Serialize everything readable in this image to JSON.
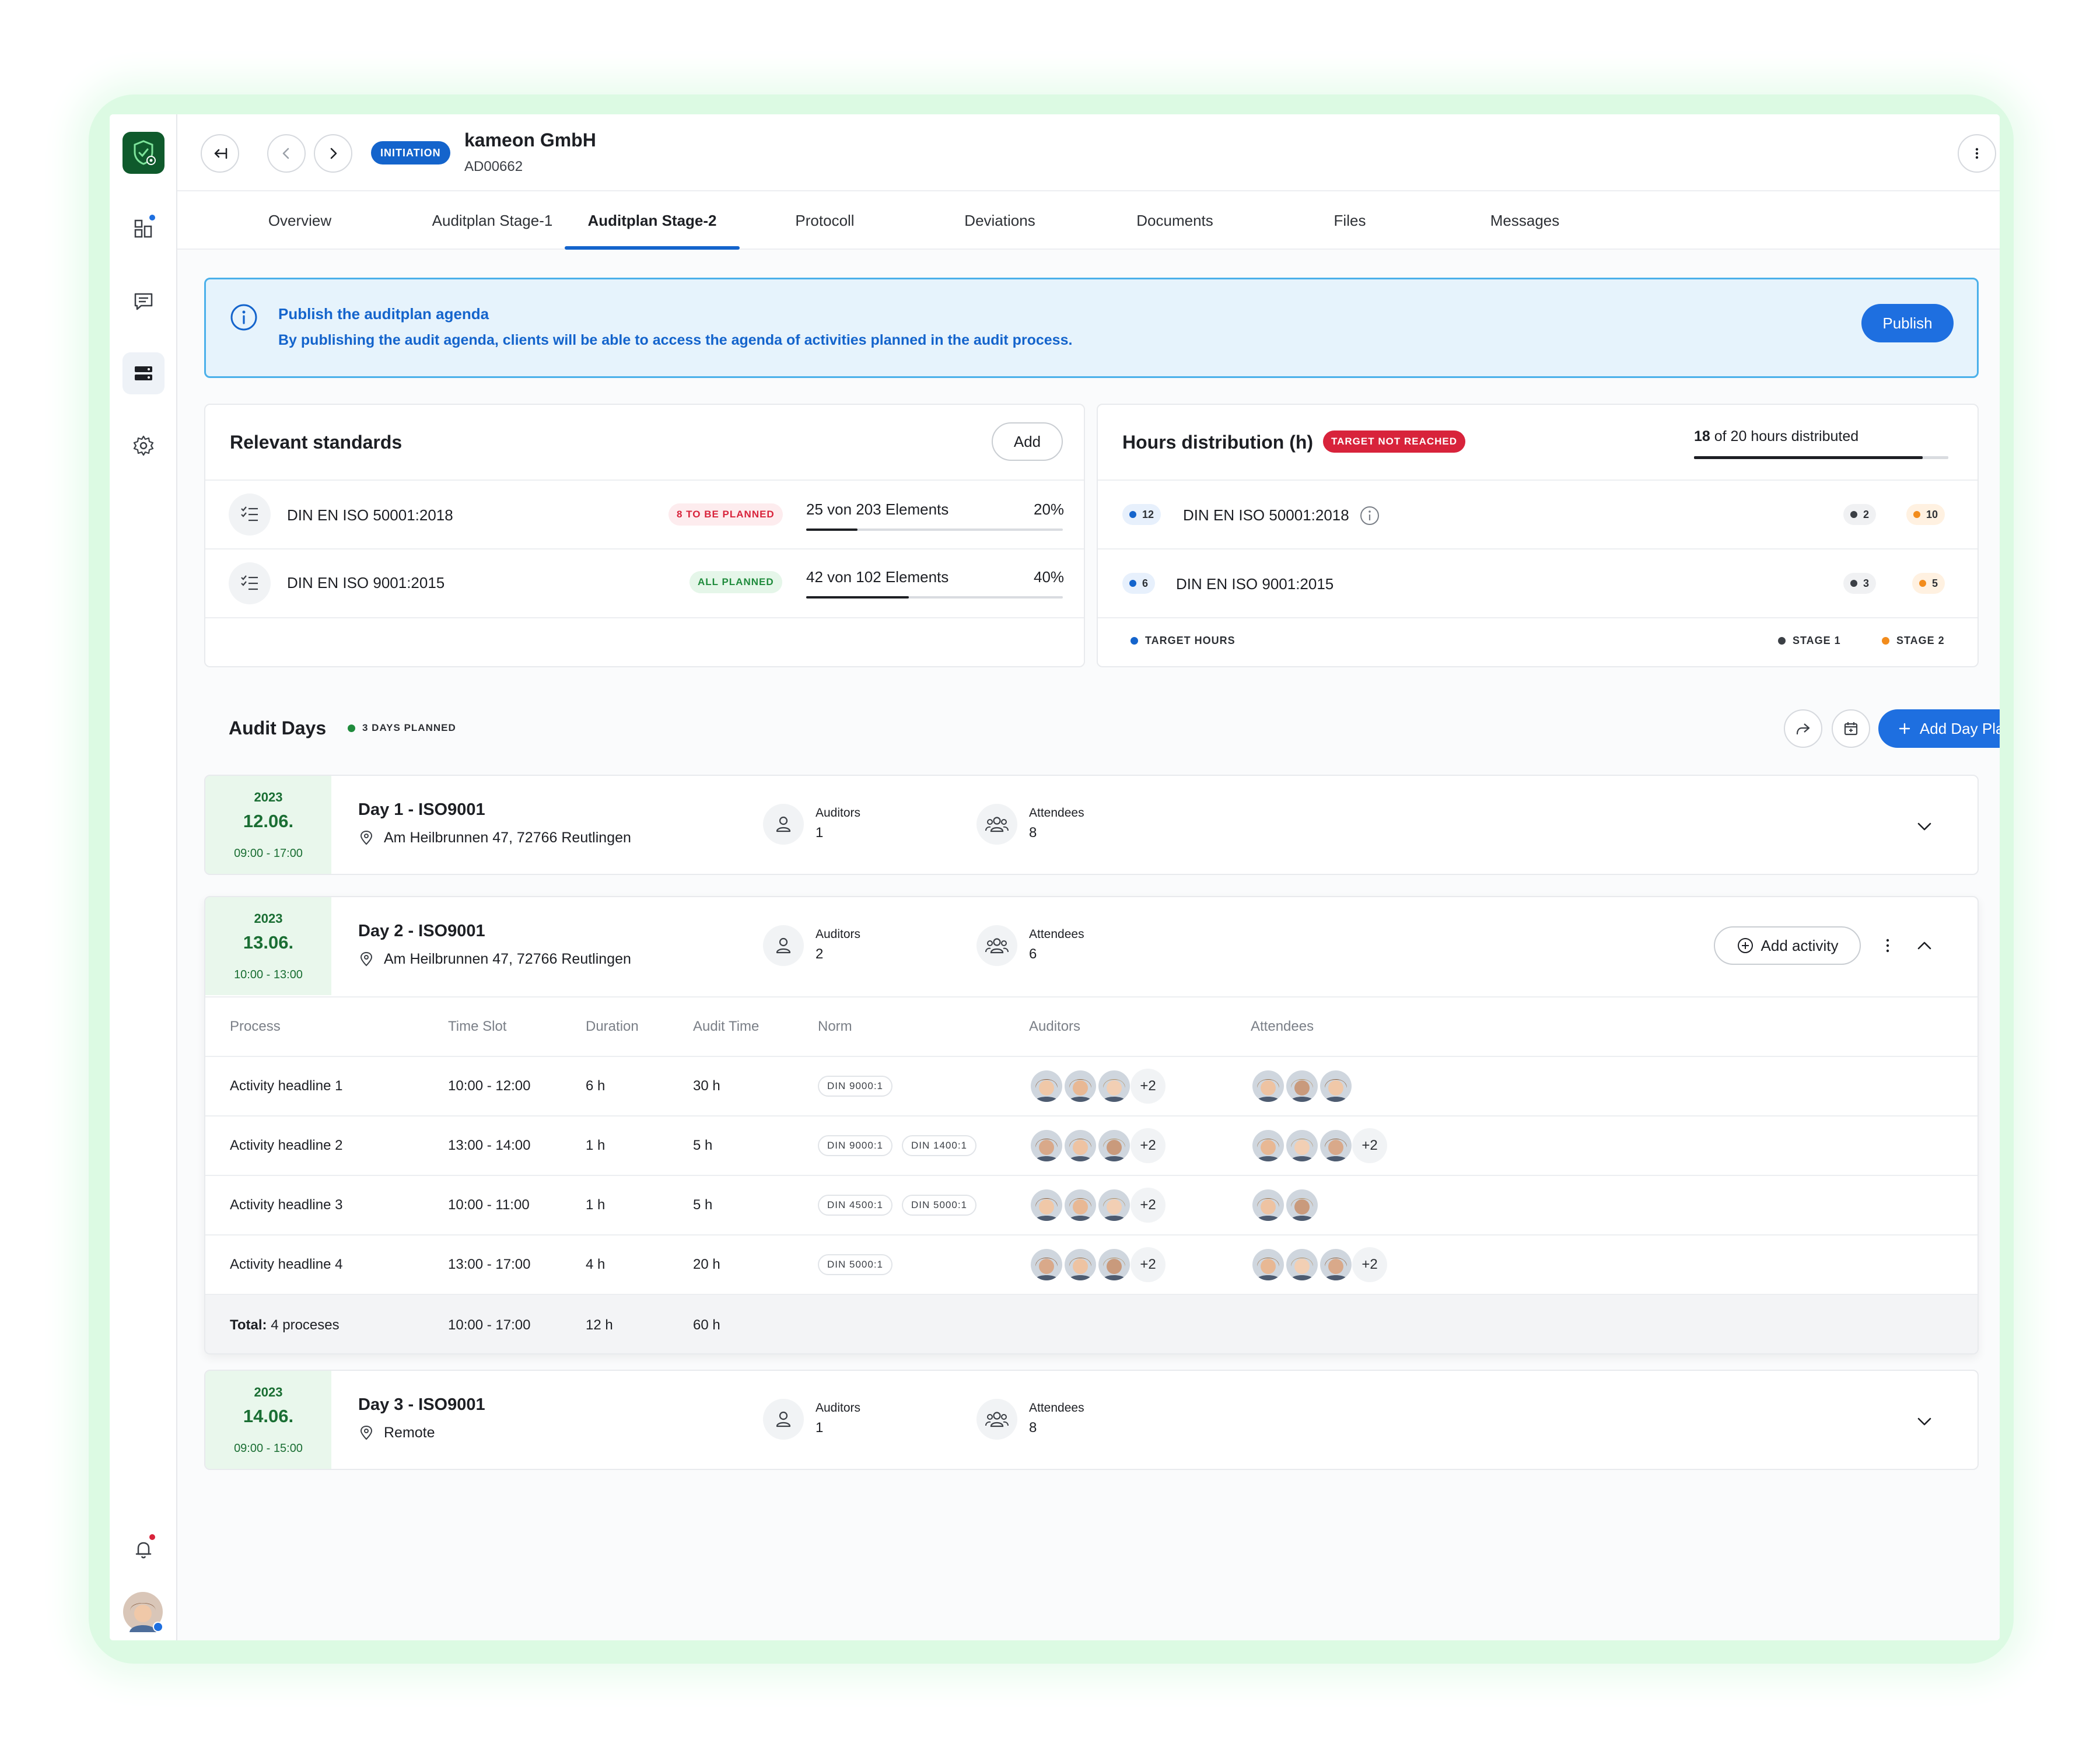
{
  "header": {
    "badge": "INITIATION",
    "company": "kameon GmbH",
    "company_id": "AD00662"
  },
  "tabs": [
    "Overview",
    "Auditplan Stage-1",
    "Auditplan Stage-2",
    "Protocoll",
    "Deviations",
    "Documents",
    "Files",
    "Messages"
  ],
  "active_tab": "Auditplan Stage-2",
  "banner": {
    "title": "Publish the auditplan agenda",
    "text": "By publishing the audit agenda, clients will be able to access the agenda of activities planned in the audit process.",
    "button": "Publish"
  },
  "standards": {
    "title": "Relevant standards",
    "add_label": "Add",
    "items": [
      {
        "name": "DIN EN ISO 50001:2018",
        "status": "8 TO BE PLANNED",
        "status_type": "red",
        "elements": "25 von 203 Elements",
        "percent_label": "20%",
        "progress": 0.2
      },
      {
        "name": "DIN EN ISO 9001:2015",
        "status": "ALL PLANNED",
        "status_type": "green",
        "elements": "42 von 102 Elements",
        "percent_label": "40%",
        "progress": 0.4
      }
    ]
  },
  "hours": {
    "title": "Hours distribution (h)",
    "badge": "TARGET NOT REACHED",
    "distributed_num": "18",
    "distributed_text": "of 20 hours distributed",
    "progress": 0.9,
    "rows": [
      {
        "target": "12",
        "name": "DIN EN ISO 50001:2018",
        "stage1": "2",
        "stage2": "10",
        "info": true
      },
      {
        "target": "6",
        "name": "DIN EN ISO 9001:2015",
        "stage1": "3",
        "stage2": "5",
        "info": false
      }
    ],
    "legend": {
      "target": "TARGET HOURS",
      "stage1": "STAGE 1",
      "stage2": "STAGE 2"
    }
  },
  "audit_days": {
    "title": "Audit Days",
    "badge": "3 DAYS PLANNED",
    "add_label": "Add Day Planning",
    "auditors_label": "Auditors",
    "attendees_label": "Attendees",
    "add_activity_label": "Add activity",
    "days": [
      {
        "year": "2023",
        "date": "12.06.",
        "time": "09:00 - 17:00",
        "title": "Day 1 - ISO9001",
        "location": "Am Heilbrunnen 47, 72766 Reutlingen",
        "auditors": "1",
        "attendees": "8"
      },
      {
        "year": "2023",
        "date": "13.06.",
        "time": "10:00 - 13:00",
        "title": "Day 2 - ISO9001",
        "location": "Am Heilbrunnen 47, 72766 Reutlingen",
        "auditors": "2",
        "attendees": "6"
      },
      {
        "year": "2023",
        "date": "14.06.",
        "time": "09:00 - 15:00",
        "title": "Day 3 - ISO9001",
        "location": "Remote",
        "auditors": "1",
        "attendees": "8"
      }
    ]
  },
  "activities": {
    "columns": [
      "Process",
      "Time Slot",
      "Duration",
      "Audit Time",
      "Norm",
      "Auditors",
      "Attendees"
    ],
    "rows": [
      {
        "process": "Activity headline 1",
        "slot": "10:00 - 12:00",
        "duration": "6 h",
        "audit_time": "30 h",
        "norms": [
          "DIN 9000:1"
        ],
        "auditor_more": "+2",
        "attendee_count": 3,
        "attendee_more": ""
      },
      {
        "process": "Activity headline 2",
        "slot": "13:00 - 14:00",
        "duration": "1 h",
        "audit_time": "5 h",
        "norms": [
          "DIN 9000:1",
          "DIN 1400:1"
        ],
        "auditor_more": "+2",
        "attendee_count": 3,
        "attendee_more": "+2"
      },
      {
        "process": "Activity headline 3",
        "slot": "10:00 - 11:00",
        "duration": "1 h",
        "audit_time": "5 h",
        "norms": [
          "DIN 4500:1",
          "DIN 5000:1"
        ],
        "auditor_more": "+2",
        "attendee_count": 2,
        "attendee_more": ""
      },
      {
        "process": "Activity headline 4",
        "slot": "13:00 - 17:00",
        "duration": "4 h",
        "audit_time": "20 h",
        "norms": [
          "DIN 5000:1"
        ],
        "auditor_more": "+2",
        "attendee_count": 3,
        "attendee_more": "+2"
      }
    ],
    "total": {
      "label": "Total:",
      "value": "4 proceses",
      "slot": "10:00 - 17:00",
      "duration": "12 h",
      "audit_time": "60 h"
    }
  },
  "colors": {
    "primary": "#1e6fe0",
    "brand_dark": "#0f5a2c",
    "target": "#1464cc",
    "stage1": "#3b3f45",
    "stage2": "#f28c1c",
    "danger": "#d8233b",
    "success": "#1f8b3c"
  }
}
